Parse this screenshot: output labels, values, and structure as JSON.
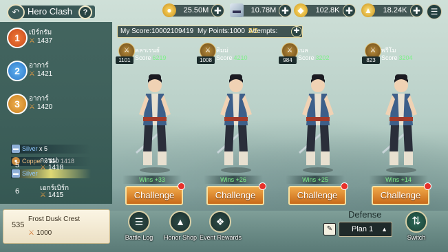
{
  "header": {
    "title": "Hero Clash",
    "back_icon": "back-arrow-icon",
    "help_icon": "question-mark-icon"
  },
  "resources": [
    {
      "name": "coin",
      "icon": "coin-icon",
      "value": "25.50M"
    },
    {
      "name": "silver-ingot",
      "icon": "silver-ingot-icon",
      "value": "10.78M"
    },
    {
      "name": "gold-ingot",
      "icon": "gold-ingot-icon",
      "value": "102.8K"
    },
    {
      "name": "gold-yuanbao",
      "icon": "yuanbao-icon",
      "value": "18.24K"
    }
  ],
  "score_bar": {
    "my_score": "My Score:10002109419",
    "my_points": "My Points:1000",
    "attempts_label": "Attempts:",
    "attempts_value": "5/5"
  },
  "leaderboard": {
    "top": [
      {
        "rank": "1",
        "name": "เบิร์กรัม",
        "score": "1437"
      },
      {
        "rank": "2",
        "name": "อาการ์",
        "score": "1421"
      },
      {
        "rank": "3",
        "name": "อาการ์",
        "score": "1420"
      }
    ],
    "hidden_row_4_score": "1418",
    "row5": {
      "rank": "5",
      "name": "กานม่",
      "score": "1418"
    },
    "row6": {
      "rank": "6",
      "name": "เอกร์เบิร์ก",
      "score": "1415"
    },
    "reward_popup": {
      "silver_label": "Silver",
      "silver_qty": "x 5",
      "copper_label": "Copper",
      "copper_qty": "x 110",
      "silver2_label": "Silver"
    },
    "self": {
      "rank": "535",
      "name": "Frost Dusk Crest",
      "score": "1000"
    }
  },
  "opponents": [
    {
      "level": "1101",
      "name": "คลาเรนธ์",
      "score_label": "Score",
      "score": "6219",
      "wins": "Wins +33",
      "challenge": "Challenge"
    },
    {
      "level": "1008",
      "name": "คิมม่",
      "score_label": "Score",
      "score": "4210",
      "wins": "Wins +26",
      "challenge": "Challenge"
    },
    {
      "level": "984",
      "name": "เนล",
      "score_label": "Score",
      "score": "3202",
      "wins": "Wins +25",
      "challenge": "Challenge"
    },
    {
      "level": "823",
      "name": "พรีโม",
      "score_label": "Score",
      "score": "3204",
      "wins": "Wins +14",
      "challenge": "Challenge"
    }
  ],
  "bottom": {
    "battle_log": "Battle Log",
    "honor_shop": "Honor Shop",
    "event_rewards": "Event Rewards",
    "defense_title": "Defense",
    "plan_value": "Plan 1",
    "switch_label": "Switch"
  },
  "colors": {
    "accent_orange": "#e08a30",
    "win_green": "#7ff08a",
    "panel_teal": "#375a55"
  }
}
